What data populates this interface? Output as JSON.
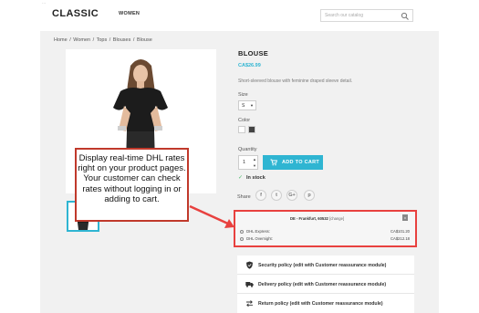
{
  "header": {
    "logo": "CLASSIC",
    "nav": [
      "WOMEN"
    ],
    "search_placeholder": "Search our catalog",
    "tick": "..."
  },
  "breadcrumb": "Home / Women / Tops / Blouses / Blouse",
  "product": {
    "title": "BLOUSE",
    "price": "CA$26.99",
    "description": "Short-sleeved blouse with feminine draped sleeve detail.",
    "size_label": "Size",
    "size_value": "S",
    "color_label": "Color",
    "colors": [
      "#ffffff",
      "#434343"
    ],
    "quantity_label": "Quantity",
    "quantity_value": "1",
    "add_to_cart": "ADD TO CART",
    "stock": "In stock",
    "share_label": "Share",
    "share_icons": [
      "f",
      "t",
      "G+",
      "p"
    ]
  },
  "dhl": {
    "location": "DE - Frankfurt, 60532",
    "change": "[change]",
    "badge": "x",
    "options": [
      {
        "name": "DHL Express:",
        "price": "CA$101.20"
      },
      {
        "name": "DHL Overnight:",
        "price": "CA$212.18"
      }
    ]
  },
  "callout": {
    "text": "Display real-time DHL rates right on your product pages. Your customer can check rates without logging in or adding to cart."
  },
  "reassurance": [
    "Security policy (edit with Customer reassurance module)",
    "Delivery policy (edit with Customer reassurance module)",
    "Return policy (edit with Customer reassurance module)"
  ],
  "colors": {
    "accent": "#2fb5d2",
    "highlight_border": "#e8413f",
    "page_bg": "#f1f1f1",
    "stock_green": "#4cbb6c"
  }
}
